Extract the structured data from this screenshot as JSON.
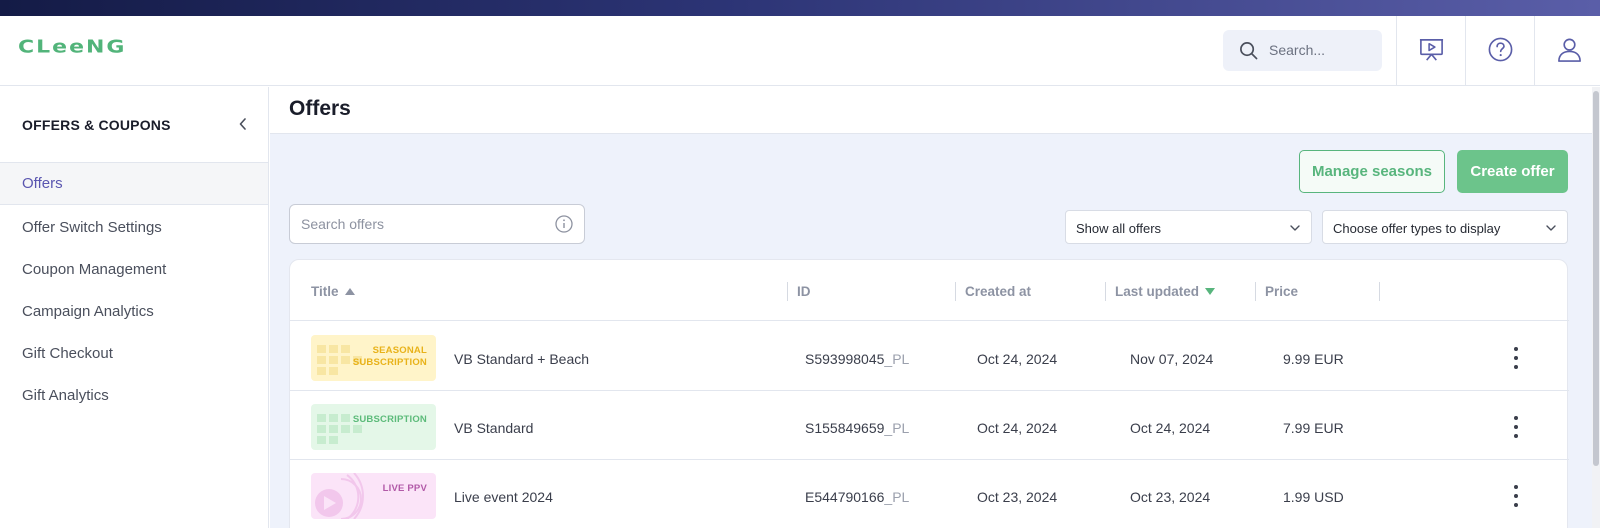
{
  "app": {
    "logo_text": "CLeeNG",
    "search_placeholder": "Search...",
    "brand_color": "#52b47a"
  },
  "header_icons": [
    "search-icon",
    "presentation-play-icon",
    "help-circle-icon",
    "user-icon"
  ],
  "sidebar": {
    "title": "OFFERS & COUPONS",
    "items": [
      {
        "label": "Offers",
        "active": true
      },
      {
        "label": "Offer Switch Settings",
        "active": false
      },
      {
        "label": "Coupon Management",
        "active": false
      },
      {
        "label": "Campaign Analytics",
        "active": false
      },
      {
        "label": "Gift Checkout",
        "active": false
      },
      {
        "label": "Gift Analytics",
        "active": false
      }
    ]
  },
  "main": {
    "title": "Offers",
    "manage_seasons_label": "Manage seasons",
    "create_offer_label": "Create offer",
    "search_placeholder": "Search offers",
    "filter_show": "Show all offers",
    "filter_types": "Choose offer types to display"
  },
  "table": {
    "columns": [
      "Title",
      "ID",
      "Created at",
      "Last updated",
      "Price"
    ],
    "rows": [
      {
        "tag_line1": "SEASONAL",
        "tag_line2": "SUBSCRIPTION",
        "title": "VB Standard + Beach",
        "id": "S593998045",
        "id_suffix": "_PL",
        "created": "Oct 24, 2024",
        "updated": "Nov 07, 2024",
        "price": "9.99 EUR",
        "theme": "seasonal"
      },
      {
        "tag_line1": "",
        "tag_line2": "SUBSCRIPTION",
        "title": "VB Standard",
        "id": "S155849659",
        "id_suffix": "_PL",
        "created": "Oct 24, 2024",
        "updated": "Oct 24, 2024",
        "price": "7.99 EUR",
        "theme": "subscription"
      },
      {
        "tag_line1": "",
        "tag_line2": "LIVE PPV",
        "title": "Live event 2024",
        "id": "E544790166",
        "id_suffix": "_PL",
        "created": "Oct 23, 2024",
        "updated": "Oct 23, 2024",
        "price": "1.99 USD",
        "theme": "live"
      }
    ]
  }
}
